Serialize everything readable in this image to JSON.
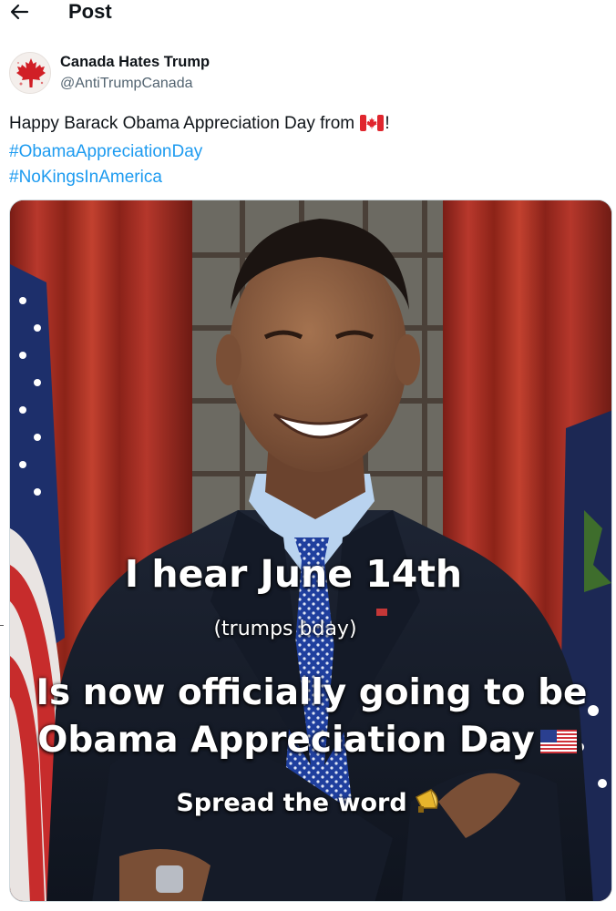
{
  "header": {
    "title": "Post",
    "back_icon": "arrow-left-icon"
  },
  "author": {
    "display_name": "Canada Hates Trump",
    "handle": "@AntiTrumpCanada",
    "avatar_icon": "maple-leaf-icon"
  },
  "tweet": {
    "text_before_flag": "Happy Barack Obama Appreciation Day from ",
    "flag_icon": "canada-flag-icon",
    "text_after_flag": "!",
    "hashtags": [
      "#ObamaAppreciationDay",
      "#NoKingsInAmerica"
    ]
  },
  "media": {
    "overlay_lines": {
      "line1": "I hear June 14th",
      "line2": "(trumps bday)",
      "line3": "Is now officially going to be",
      "line4": "Obama Appreciation Day",
      "line5": "Spread the word"
    },
    "line4_icon": "us-flag-icon",
    "line5_icon": "megaphone-icon"
  },
  "colors": {
    "link": "#1d9bf0",
    "text": "#0f1419",
    "secondary": "#536471"
  }
}
